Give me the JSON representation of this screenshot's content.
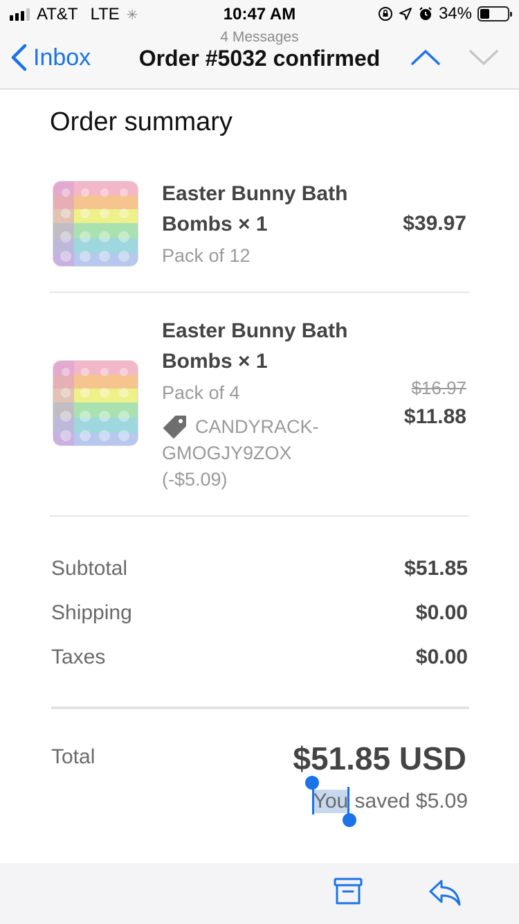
{
  "status_bar": {
    "carrier": "AT&T",
    "network": "LTE",
    "time": "10:47 AM",
    "battery": "34%",
    "battery_level": 0.34
  },
  "nav": {
    "back_label": "Inbox",
    "message_count": "4 Messages",
    "title": "Order #5032 confirmed"
  },
  "order": {
    "heading": "Order summary",
    "items": [
      {
        "name": "Easter Bunny Bath Bombs × 1",
        "variant": "Pack of 12",
        "price": "$39.97"
      },
      {
        "name": "Easter Bunny Bath Bombs × 1",
        "variant": "Pack of 4",
        "original_price": "$16.97",
        "price": "$11.88",
        "discount": "CANDYRACK-GMOGJY9ZOX (-$5.09)"
      }
    ],
    "subtotal_label": "Subtotal",
    "subtotal": "$51.85",
    "shipping_label": "Shipping",
    "shipping": "$0.00",
    "taxes_label": "Taxes",
    "taxes": "$0.00",
    "total_label": "Total",
    "total": "$51.85 USD",
    "saved_selected": "You",
    "saved_rest": " saved $5.09"
  },
  "colors": {
    "accent": "#1a73e8",
    "selection": "#c7d9ee"
  },
  "icons": {
    "back": "chevron-left-icon",
    "previous": "chevron-up-icon",
    "next": "chevron-down-icon",
    "tag": "price-tag-icon",
    "archive": "archive-box-icon",
    "reply": "reply-arrow-icon"
  }
}
